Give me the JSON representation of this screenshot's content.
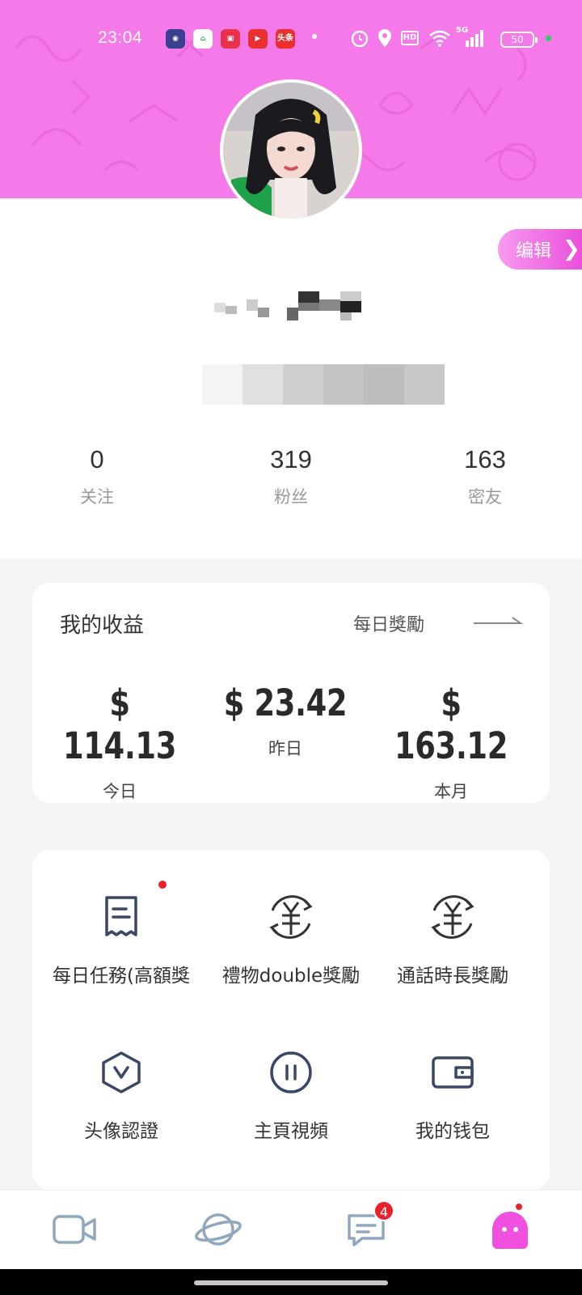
{
  "status_bar": {
    "time": "23:04",
    "network": "5G",
    "battery": "50",
    "hd_label": "HD",
    "notif_label": "头条",
    "icons": [
      "camera-app-icon",
      "home-app-icon",
      "shop-app-icon",
      "video-app-icon",
      "news-app-icon",
      "alarm-icon",
      "location-icon",
      "wifi-icon",
      "signal-icon"
    ]
  },
  "profile": {
    "edit_label": "编辑"
  },
  "stats": [
    {
      "value": "0",
      "label": "关注"
    },
    {
      "value": "319",
      "label": "粉丝"
    },
    {
      "value": "163",
      "label": "密友"
    }
  ],
  "earnings": {
    "title": "我的收益",
    "daily_reward": "每日獎勵",
    "items": [
      {
        "value": "$ 114.13",
        "label": "今日"
      },
      {
        "value": "$ 23.42",
        "label": "昨日"
      },
      {
        "value": "$ 163.12",
        "label": "本月"
      }
    ]
  },
  "menu": [
    {
      "label": "每日任務(高額獎",
      "icon": "task-receipt-icon",
      "has_dot": true
    },
    {
      "label": "禮物double獎勵",
      "icon": "yuan-exchange-icon",
      "has_dot": false
    },
    {
      "label": "通話時長獎勵",
      "icon": "yuan-exchange-icon",
      "has_dot": false
    },
    {
      "label": "头像認證",
      "icon": "verify-hexagon-icon",
      "has_dot": false
    },
    {
      "label": "主頁視頻",
      "icon": "pause-circle-icon",
      "has_dot": false
    },
    {
      "label": "我的钱包",
      "icon": "wallet-icon",
      "has_dot": false
    }
  ],
  "tabbar": {
    "message_badge": "4",
    "tabs": [
      "video-camera-icon",
      "planet-icon",
      "message-icon",
      "profile-ghost-icon"
    ]
  },
  "colors": {
    "brand_pink": "#f579e8",
    "badge_red": "#e8222d",
    "icon_navy": "#3a4766"
  }
}
